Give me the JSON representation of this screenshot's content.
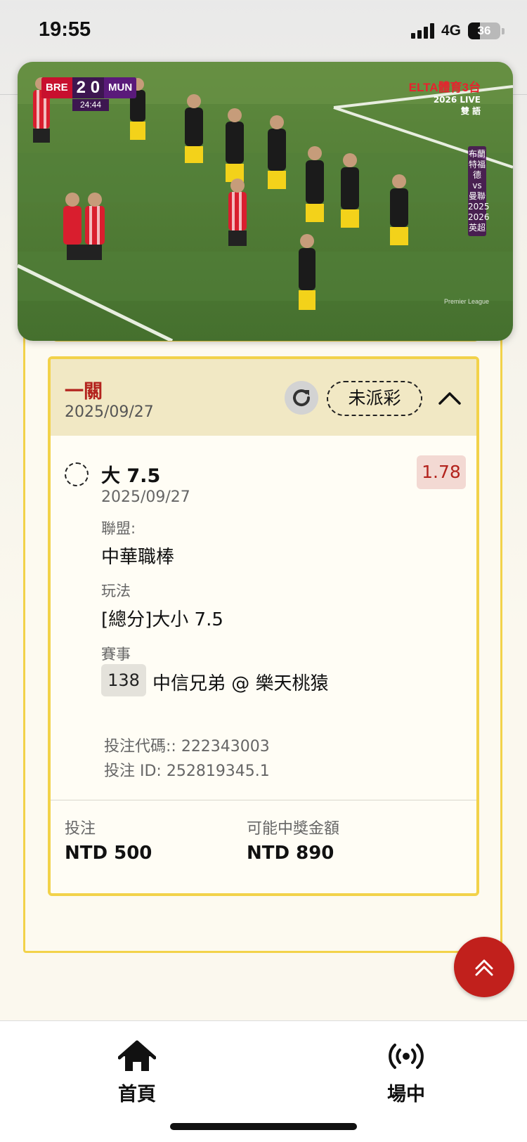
{
  "status_bar": {
    "time": "19:55",
    "network": "4G",
    "battery": "36",
    "battery_level": 0.36
  },
  "video": {
    "home_team": "BRE",
    "away_team": "MUN",
    "score": "2 0",
    "match_clock": "24:44",
    "broadcaster": "ELTA體育3台",
    "broadcast_line1": "2026 LIVE",
    "broadcast_line2": "雙 語",
    "competition_tag": "布蘭特福德 vs 曼聯 2025 2026 英超",
    "watermark": "Premier League"
  },
  "bet": {
    "type": "一關",
    "date": "2025/09/27",
    "status_label": "未派彩",
    "selection": {
      "name": "大 7.5",
      "date": "2025/09/27",
      "odds": "1.78"
    },
    "league_label": "聯盟:",
    "league": "中華職棒",
    "market_label": "玩法",
    "market": "[總分]大小 7.5",
    "event_label": "賽事",
    "event_number": "138",
    "event_name": "中信兄弟 @ 樂天桃猿",
    "bet_code": "投注代碼:: 222343003",
    "bet_id": "投注 ID: 252819345.1",
    "stake_label": "投注",
    "stake": "NTD 500",
    "payout_label": "可能中獎金額",
    "payout": "NTD 890"
  },
  "tabs": [
    {
      "label": "首頁",
      "icon": "home-icon"
    },
    {
      "label": "場中",
      "icon": "live-broadcast-icon"
    }
  ],
  "colors": {
    "accent": "#f2d24a",
    "brand_red": "#c1201c",
    "header_bg": "#f1e8c4"
  }
}
